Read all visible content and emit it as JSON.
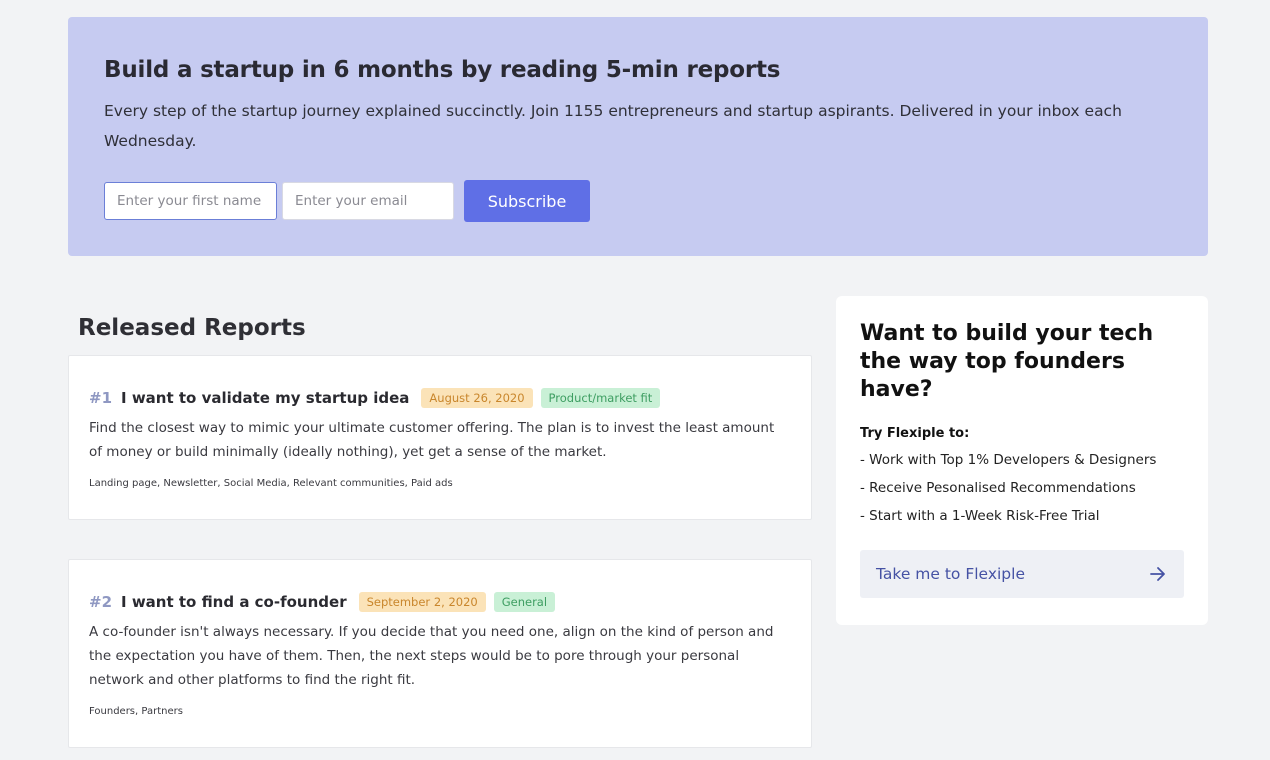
{
  "hero": {
    "title": "Build a startup in 6 months by reading 5-min reports",
    "description": "Every step of the startup journey explained succinctly. Join 1155 entrepreneurs and startup aspirants. Delivered in your inbox each Wednesday.",
    "first_name_placeholder": "Enter your first name",
    "email_placeholder": "Enter your email",
    "subscribe_label": "Subscribe"
  },
  "reports": {
    "section_title": "Released Reports",
    "items": [
      {
        "number": "#1",
        "title": "I want to validate my startup idea",
        "date": "August 26, 2020",
        "category": "Product/market fit",
        "description": "Find the closest way to mimic your ultimate customer offering. The plan is to invest the least amount of money or build minimally (ideally nothing), yet get a sense of the market.",
        "tags": "Landing page, Newsletter, Social Media, Relevant communities, Paid ads"
      },
      {
        "number": "#2",
        "title": "I want to find a co-founder",
        "date": "September 2, 2020",
        "category": "General",
        "description": "A co-founder isn't always necessary. If you decide that you need one, align on the kind of person and the expectation you have of them. Then, the next steps would be to pore through your personal network and other platforms to find the right fit.",
        "tags": "Founders, Partners"
      }
    ]
  },
  "sidebar": {
    "title": "Want to build your tech the way top founders have?",
    "subtitle": "Try Flexiple to:",
    "items": [
      "- Work with Top 1% Developers & Designers",
      "- Receive Pesonalised Recommendations",
      "- Start with a 1-Week Risk-Free Trial"
    ],
    "cta_label": "Take me to Flexiple",
    "cta_icon": "arrow-right-icon"
  },
  "colors": {
    "hero_bg": "#c6cbf1",
    "accent": "#5f6fe6",
    "date_tag_bg": "#fbe3b8",
    "category_tag_bg": "#c9f0d6"
  }
}
